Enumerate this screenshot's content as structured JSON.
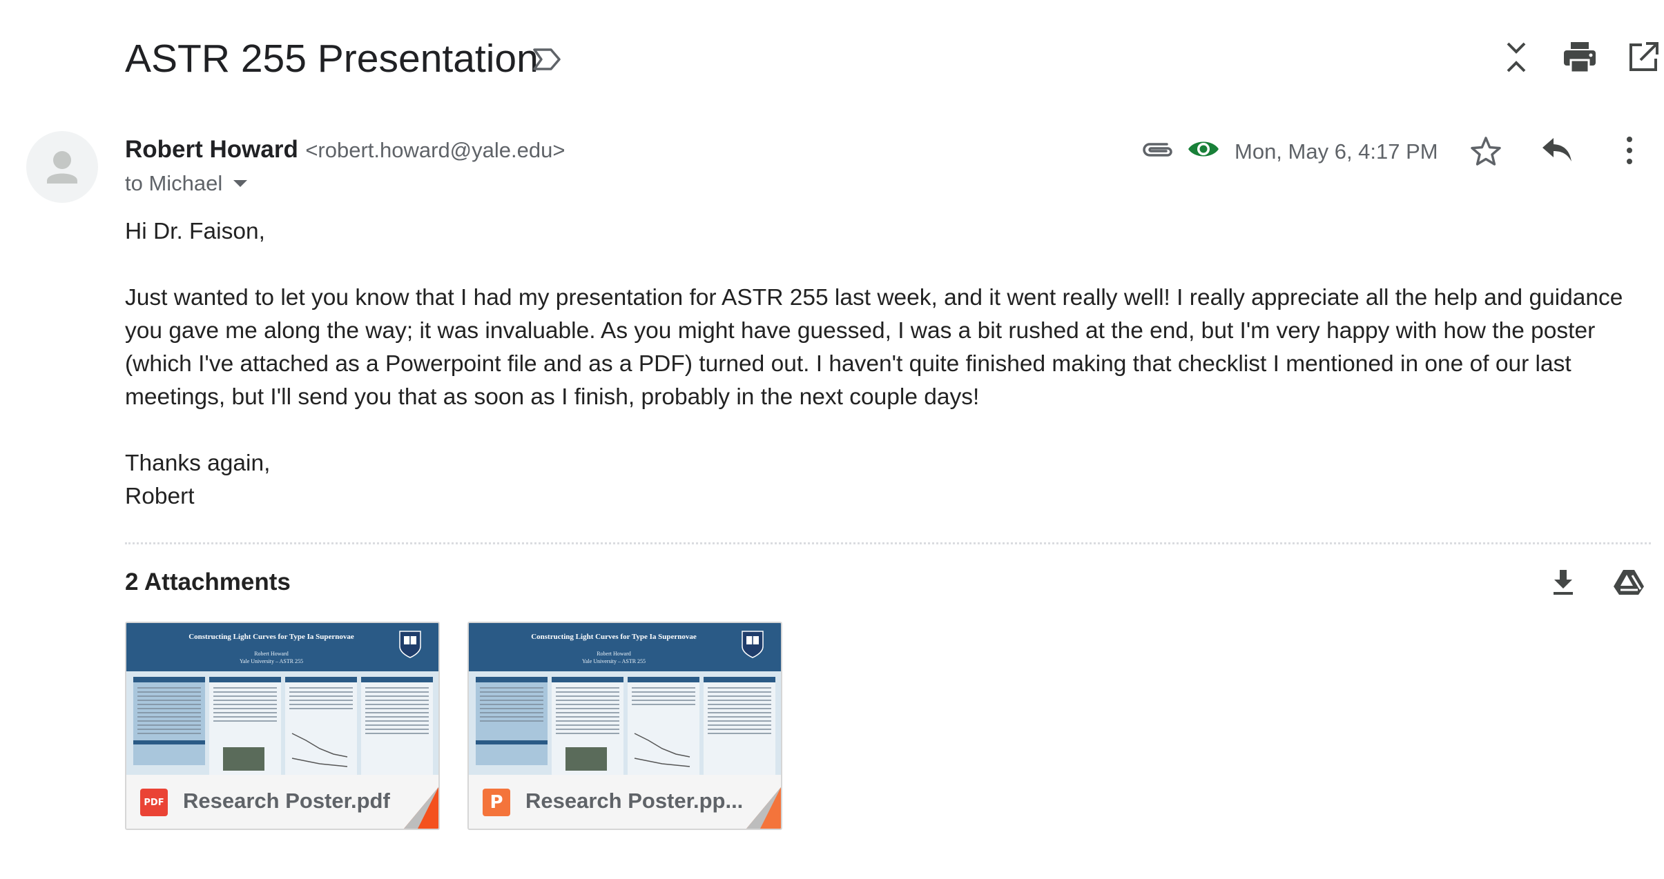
{
  "email": {
    "subject": "ASTR 255 Presentation",
    "sender": {
      "name": "Robert Howard",
      "email": "<robert.howard@yale.edu>"
    },
    "recipient_line": "to Michael",
    "date": "Mon, May 6, 4:17 PM",
    "body": {
      "greeting": "Hi Dr. Faison,",
      "paragraph": "Just wanted to let you know that I had my presentation for ASTR 255 last week, and it went really well! I really appreciate all the help and guidance you gave me along the way; it was invaluable. As you might have guessed, I was a bit rushed at the end, but I'm very happy with how the poster (which I've attached as a Powerpoint file and as a PDF) turned out. I haven't quite finished making that checklist I mentioned in one of our last meetings, but I'll send you that as soon as I finish, probably in the next couple days!",
      "closing": "Thanks again,",
      "signature": "Robert"
    }
  },
  "attachments": {
    "title": "2 Attachments",
    "files": [
      {
        "name": "Research Poster.pdf",
        "badge": "PDF",
        "badge_color": "#ea4335",
        "fold_color": "#f4511e",
        "poster_title": "Constructing Light Curves for Type Ia Supernovae",
        "poster_author": "Robert Howard",
        "poster_affiliation": "Yale University – ASTR 255"
      },
      {
        "name": "Research Poster.pp...",
        "badge": "P",
        "badge_color": "#f4743b",
        "fold_color": "#f4743b",
        "poster_title": "Constructing Light Curves for Type Ia Supernovae",
        "poster_author": "Robert Howard",
        "poster_affiliation": "Yale University – ASTR 255"
      }
    ]
  },
  "icons": {
    "label": "label-outline-icon",
    "collapse_all": "unfold-less-icon",
    "print": "print-icon",
    "open_new_window": "open-in-new-icon",
    "attachment": "paperclip-icon",
    "tracking": "eye-icon",
    "star": "star-outline-icon",
    "reply": "reply-icon",
    "more": "more-vert-icon",
    "download_all": "download-icon",
    "save_to_drive": "google-drive-icon"
  },
  "colors": {
    "eye_icon": "#188038",
    "secondary_text": "#5f6368",
    "icon_dark": "#444746"
  }
}
